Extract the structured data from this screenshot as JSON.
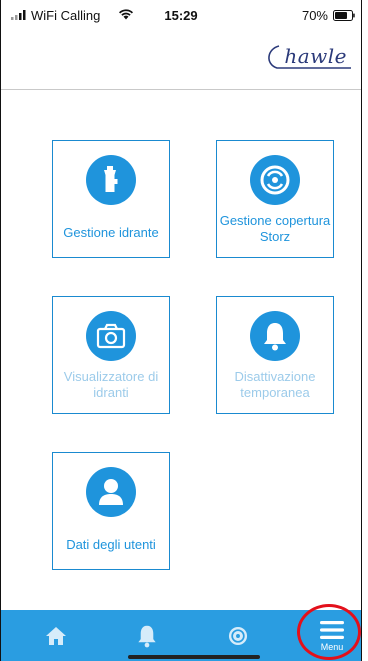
{
  "status_bar": {
    "carrier": "WiFi Calling",
    "time": "15:29",
    "battery": "70%"
  },
  "header": {
    "logo_text": "hawle"
  },
  "tiles": [
    {
      "label": "Gestione idrante",
      "icon": "hydrant-icon",
      "enabled": true
    },
    {
      "label": "Gestione copertura Storz",
      "icon": "storz-cover-icon",
      "enabled": true
    },
    {
      "label": "Visualizzatore di idranti",
      "icon": "camera-icon",
      "enabled": false
    },
    {
      "label": "Disattivazione temporanea",
      "icon": "bell-icon",
      "enabled": false
    },
    {
      "label": "Dati degli utenti",
      "icon": "user-icon",
      "enabled": true
    }
  ],
  "bottom_nav": {
    "items": [
      {
        "icon": "home-icon"
      },
      {
        "icon": "bell-icon"
      },
      {
        "icon": "storz-cover-icon"
      },
      {
        "icon": "menu-icon",
        "label": "Menu"
      }
    ]
  },
  "colors": {
    "accent": "#1f94dc",
    "nav_background": "#2a9de1",
    "disabled_text": "#9ccbea",
    "highlight": "#e3101b",
    "logo": "#2b3a7a"
  }
}
